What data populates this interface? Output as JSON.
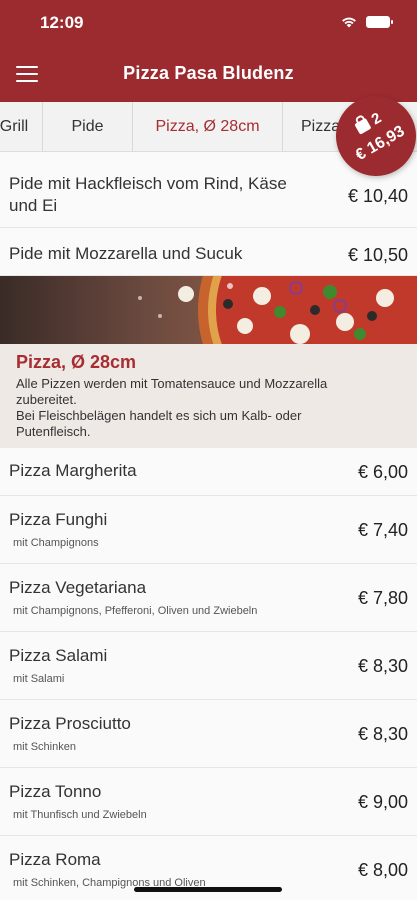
{
  "status": {
    "time": "12:09"
  },
  "header": {
    "title": "Pizza Pasa Bludenz"
  },
  "tabs": [
    {
      "label": "Grill"
    },
    {
      "label": "Pide"
    },
    {
      "label": "Pizza, Ø 28cm"
    },
    {
      "label": "Pizza"
    }
  ],
  "cart": {
    "count": "2",
    "total": "€ 16,93"
  },
  "pide_items": [
    {
      "name": "Pide mit Hackfleisch vom Rind, Käse und Ei",
      "price": "€ 10,40"
    },
    {
      "name": "Pide mit Mozzarella und Sucuk",
      "price": "€ 10,50"
    }
  ],
  "category": {
    "title": "Pizza, Ø 28cm",
    "description_1": "Alle Pizzen werden mit Tomatensauce und Mozzarella zubereitet.",
    "description_2": "Bei Fleischbelägen handelt es sich um Kalb- oder Putenfleisch."
  },
  "pizza_items": [
    {
      "name": "Pizza Margherita",
      "desc": "",
      "price": "€ 6,00"
    },
    {
      "name": "Pizza Funghi",
      "desc": "mit Champignons",
      "price": "€ 7,40"
    },
    {
      "name": "Pizza Vegetariana",
      "desc": "mit Champignons, Pfefferoni, Oliven und Zwiebeln",
      "price": "€ 7,80"
    },
    {
      "name": "Pizza Salami",
      "desc": "mit Salami",
      "price": "€ 8,30"
    },
    {
      "name": "Pizza Prosciutto",
      "desc": "mit Schinken",
      "price": "€ 8,30"
    },
    {
      "name": "Pizza Tonno",
      "desc": "mit Thunfisch und Zwiebeln",
      "price": "€ 9,00"
    },
    {
      "name": "Pizza Roma",
      "desc": "mit Schinken, Champignons und Oliven",
      "price": "€ 8,00"
    }
  ],
  "icons": {
    "menu": "hamburger-icon",
    "cart": "shopping-bag-icon",
    "wifi": "wifi-icon",
    "battery": "battery-icon"
  },
  "colors": {
    "brand": "#9c2b2f",
    "accent_text": "#a72d31",
    "category_bg": "#efe9e6"
  }
}
